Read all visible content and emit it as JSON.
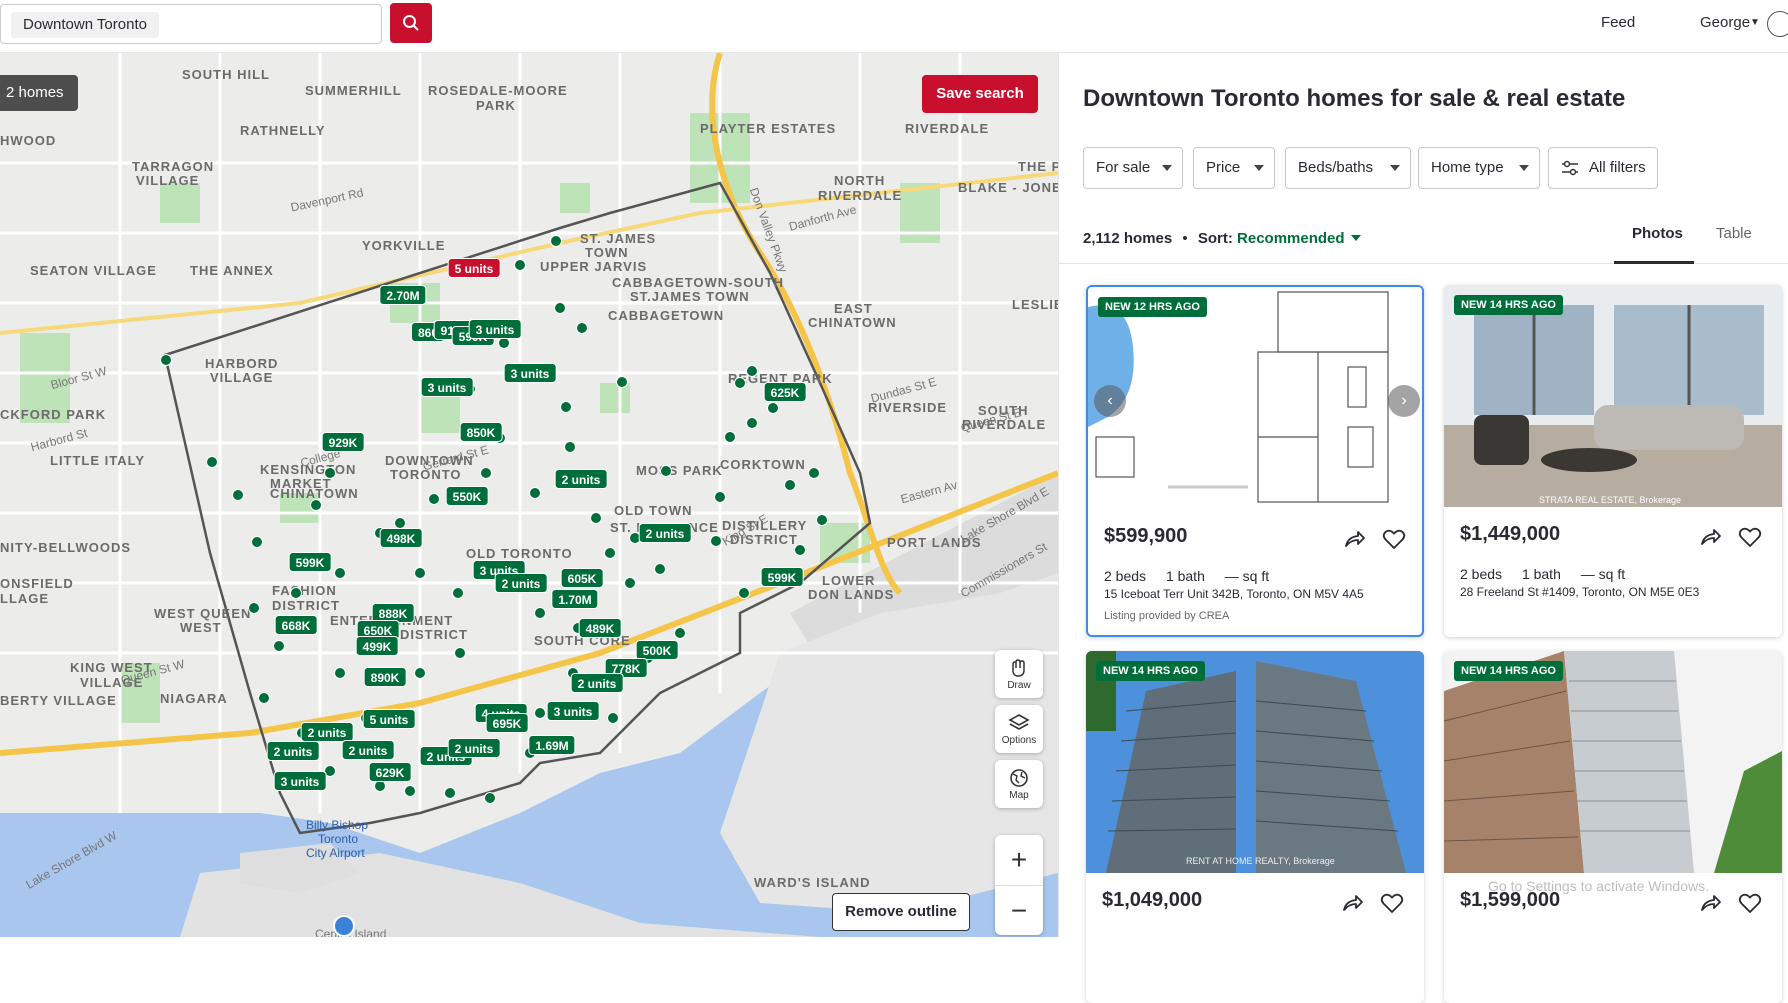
{
  "search": {
    "value": "Downtown Toronto"
  },
  "nav": {
    "feed": "Feed",
    "user": "George"
  },
  "map": {
    "homes_count": "2 homes",
    "save_search": "Save search",
    "remove_outline": "Remove outline",
    "controls": {
      "draw": "Draw",
      "options": "Options",
      "map": "Map"
    },
    "labels": {
      "south_hill": "SOUTH HILL",
      "summerhill": "SUMMERHILL",
      "rosedale_moore": "ROSEDALE-MOORE",
      "park": "PARK",
      "rathnelly": "RATHNELLY",
      "hwood": "HWOOD",
      "tarragon": "TARRAGON",
      "village": "VILLAGE",
      "yorkville": "YORKVILLE",
      "seaton": "SEATON VILLAGE",
      "annex": "THE ANNEX",
      "st_james": "ST. JAMES",
      "town": "TOWN",
      "upper_jarvis": "UPPER JARVIS",
      "cabbagetown_south": "CABBAGETOWN-SOUTH",
      "st_james_town": "ST.JAMES TOWN",
      "cabbagetown": "CABBAGETOWN",
      "playter": "PLAYTER ESTATES",
      "riverdale": "RIVERDALE",
      "north_riverdale": "NORTH",
      "north_riverdale2": "RIVERDALE",
      "blake_jones": "BLAKE - JONE",
      "the_p": "THE P",
      "east_chinatown": "EAST",
      "east_chinatown2": "CHINATOWN",
      "leslie": "LESLIE",
      "harbord": "HARBORD",
      "harbord2": "VILLAGE",
      "regent_park": "REGENT PARK",
      "riverside": "RIVERSIDE",
      "south_riverdale": "SOUTH",
      "south_riverdale2": "RIVERDALE",
      "ckford": "CKFORD PARK",
      "little_italy": "LITTLE ITALY",
      "kensington": "KENSINGTON",
      "market": "MARKET",
      "downtown": "DOWNTOWN",
      "toronto": "TORONTO",
      "moss_park": "MOSS PARK",
      "corktown": "CORKTOWN",
      "chinatown": "CHINATOWN",
      "old_town": "OLD TOWN",
      "st_lawrence": "ST. LAWRENCE",
      "distillery": "DISTILLERY",
      "district": "DISTRICT",
      "nity": "NITY-BELLWOODS",
      "onsfield": "ONSFIELD",
      "llage": "LLAGE",
      "old_toronto": "OLD TORONTO",
      "fashion": "FASHION",
      "fashion2": "DISTRICT",
      "port_lands": "PORT LANDS",
      "lower_don": "LOWER",
      "lower_don2": "DON LANDS",
      "west_queen": "WEST QUEEN",
      "west": "WEST",
      "entertainment": "ENTERTAINMENT",
      "district2": "DISTRICT",
      "south_core": "SOUTH CORE",
      "king_west": "KING WEST",
      "king_village": "VILLAGE",
      "niagara": "NIAGARA",
      "berty": "BERTY VILLAGE",
      "billy_bishop": "Billy Bishop",
      "toronto_city": "Toronto",
      "city_airport": "City Airport",
      "wards_island": "WARD'S ISLAND",
      "centre_island": "Centre Island",
      "don_valley": "Don Valley Pkwy",
      "davenport": "Davenport Rd",
      "bloor": "Bloor St W",
      "college": "College",
      "gerrard": "Gerrard St E",
      "queen_east": "Queen St E",
      "lake_shore": "Lake Shore Blvd E",
      "danforth": "Danforth Ave",
      "commissioners": "Commissioners St",
      "king_st": "King St E",
      "dundas": "Dundas St E",
      "harbord_st": "Harbord St",
      "queen_west": "Queen St W",
      "lake_shore_w": "Lake Shore Blvd W",
      "eastern": "Eastern Av"
    },
    "pins": [
      "5 units",
      "2.70M",
      "860",
      "913K",
      "599K",
      "3 units",
      "3 units",
      "3 units",
      "625K",
      "850K",
      "929K",
      "550K",
      "2 units",
      "2 units",
      "498K",
      "599K",
      "3 units",
      "2 units",
      "605K",
      "1.70M",
      "599K",
      "888K",
      "668K",
      "650K",
      "489K",
      "499K",
      "500K",
      "778K",
      "890K",
      "2 units",
      "4 units",
      "695K",
      "3 units",
      "2 units",
      "5 units",
      "2 units",
      "2 units",
      "2 units",
      "629K",
      "3 units",
      "2 units",
      "1.69M"
    ]
  },
  "panel": {
    "title": "Downtown Toronto homes for sale & real estate",
    "filters": [
      "For sale",
      "Price",
      "Beds/baths",
      "Home type",
      "All filters"
    ],
    "homes_count": "2,112 homes",
    "sort_label": "Sort:",
    "sort_value": "Recommended",
    "tabs": [
      "Photos",
      "Table"
    ],
    "listings": [
      {
        "badge": "NEW 12 HRS AGO",
        "price": "$599,900",
        "beds": "2 beds",
        "baths": "1 bath",
        "sqft": "— sq ft",
        "address": "15 Iceboat Terr Unit 342B, Toronto, ON M5V 4A5",
        "listing_by": "Listing provided by CREA"
      },
      {
        "badge": "NEW 14 HRS AGO",
        "price": "$1,449,000",
        "beds": "2 beds",
        "baths": "1 bath",
        "sqft": "— sq ft",
        "address": "28 Freeland St #1409, Toronto, ON M5E 0E3",
        "photo_credit": "STRATA REAL ESTATE, Brokerage"
      },
      {
        "badge": "NEW 14 HRS AGO",
        "price": "$1,049,000",
        "photo_credit": "RENT AT HOME REALTY, Brokerage"
      },
      {
        "badge": "NEW 14 HRS AGO",
        "price": "$1,599,000"
      }
    ],
    "watermark": "Go to Settings to activate Windows."
  }
}
